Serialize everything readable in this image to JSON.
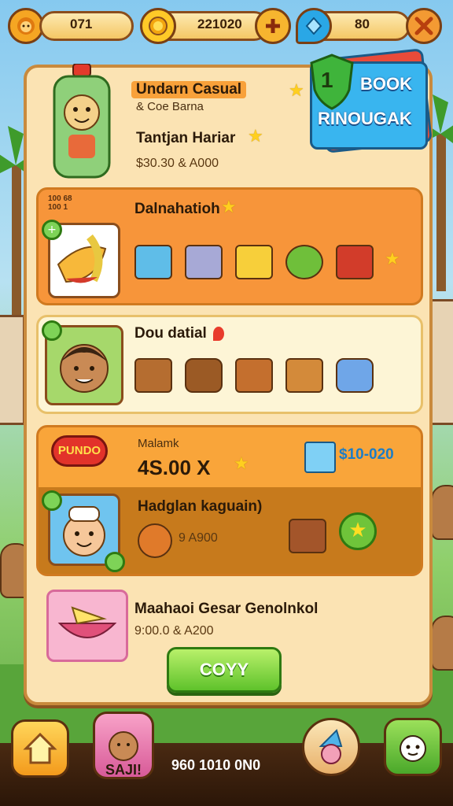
{
  "top_bar": {
    "resource_1": "071",
    "resource_2": "221020",
    "resource_3": "80",
    "left_icon": "lion-icon",
    "coin_icon": "coin-icon",
    "plus_icon": "plus-icon",
    "gem_icon": "gem-icon",
    "settings_icon": "tools-icon"
  },
  "promo": {
    "number": "1",
    "line1": "BOOK",
    "line2": "RINOUGAK"
  },
  "cards": [
    {
      "title": "Undarn Casual",
      "subtitle": "& Coe Barna",
      "name": "Tantjan Hariar",
      "price": "$30.30 & A000"
    },
    {
      "name": "Dalnahatioh",
      "badge_line1": "100 68",
      "badge_line2": "100 1",
      "plus": "+"
    },
    {
      "name": "Dou datial"
    },
    {
      "title": "Malamk",
      "sale": "PUNDO",
      "amount": "4S.00 X",
      "price_tag": "$10-020",
      "name": "Hadglan kaguain)",
      "price": "9 A900"
    },
    {
      "name": "Maahaoi Gesar Genolnkol",
      "price": "9:00.0 & A200",
      "button": "COYY"
    }
  ],
  "bottom_bar": {
    "home_icon": "home-icon",
    "pet_label": "SAJI!",
    "counts": "960  1010  0N0",
    "wizard_icon": "wizard-icon",
    "friend_icon": "friend-icon"
  },
  "colors": {
    "panel": "#fbe3b3",
    "card_orange": "#f7953a",
    "card_cream": "#fdf5d6",
    "button_green": "#5fc22b",
    "accent_blue": "#2aa7e6"
  }
}
